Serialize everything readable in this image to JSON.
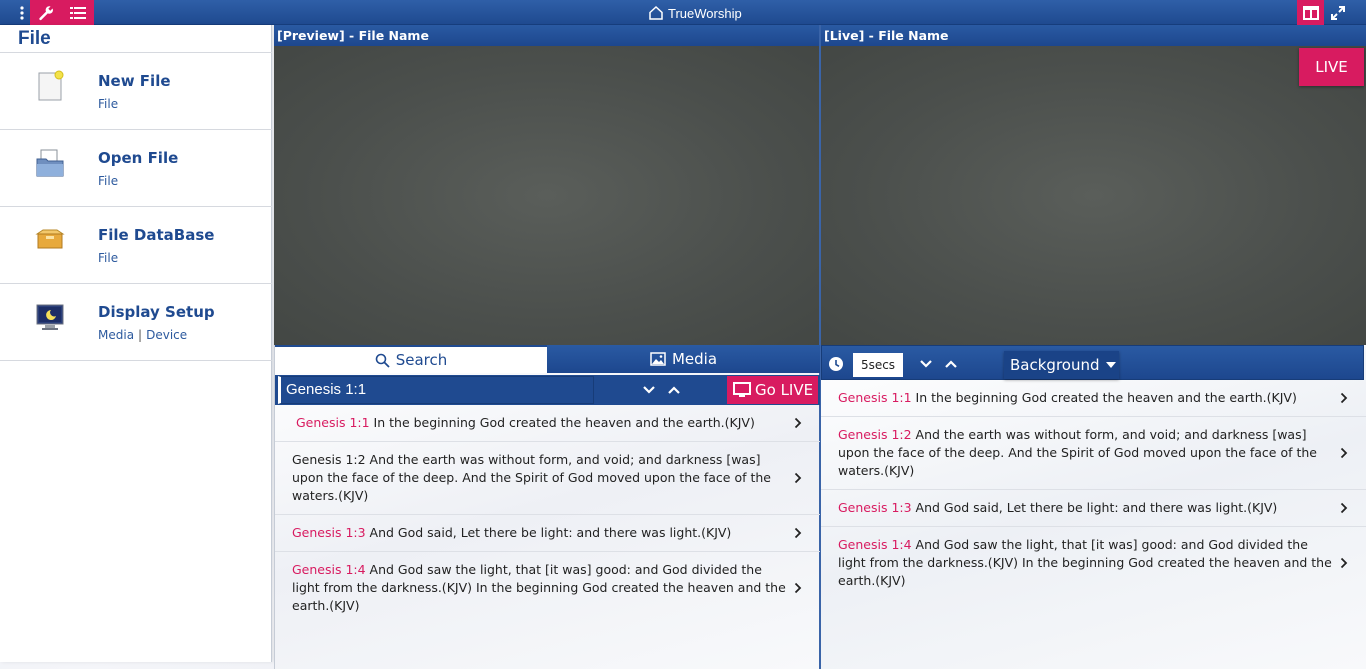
{
  "app": {
    "title": "TrueWorship"
  },
  "menu": {
    "title": "File",
    "items": [
      {
        "label": "New File",
        "sub": [
          "File"
        ],
        "icon": "new-file-icon"
      },
      {
        "label": "Open File",
        "sub": [
          "File"
        ],
        "icon": "open-file-icon"
      },
      {
        "label": "File DataBase",
        "sub": [
          "File"
        ],
        "icon": "file-database-icon"
      },
      {
        "label": "Display Setup",
        "sub": [
          "Media",
          "Device"
        ],
        "icon": "display-setup-icon"
      }
    ]
  },
  "preview": {
    "header": "[Preview]  - File Name"
  },
  "live": {
    "header": "[Live]  - File Name",
    "badge": "LIVE"
  },
  "tabs": {
    "search": "Search",
    "media": "Media"
  },
  "search": {
    "value": "Genesis 1:1",
    "go_live": "Go LIVE"
  },
  "preview_verses": [
    {
      "ref": "Genesis 1:1",
      "text": " In the beginning God created the heaven and the earth.(KJV)",
      "highlight": true
    },
    {
      "ref": "Genesis 1:2",
      "text": " And the earth was without form, and void; and darkness [was] upon the face of the deep. And the Spirit of God moved upon the face of the waters.(KJV)",
      "highlight": false
    },
    {
      "ref": "Genesis 1:3",
      "text": " And God said, Let there be light: and there was light.(KJV)",
      "highlight": true
    },
    {
      "ref": "Genesis 1:4",
      "text": " And God saw the light, that [it was] good: and God divided the light from the darkness.(KJV) In the beginning God created the heaven and the earth.(KJV)",
      "highlight": true
    }
  ],
  "live_toolbar": {
    "interval": "5secs",
    "background": "Background"
  },
  "live_verses": [
    {
      "ref": "Genesis 1:1",
      "text": " In the beginning God created the heaven and the earth.(KJV)"
    },
    {
      "ref": "Genesis 1:2",
      "text": " And the earth was without form, and void; and darkness [was] upon the face of the deep. And the Spirit of God moved upon the face of the waters.(KJV)"
    },
    {
      "ref": "Genesis 1:3",
      "text": " And God said, Let there be light: and there was light.(KJV)"
    },
    {
      "ref": "Genesis 1:4",
      "text": " And God saw the light, that [it was] good: and God divided the light from the darkness.(KJV) In the beginning God created the heaven and the earth.(KJV)"
    }
  ],
  "colors": {
    "brand_blue": "#1f4a90",
    "accent_pink": "#d81b60"
  }
}
